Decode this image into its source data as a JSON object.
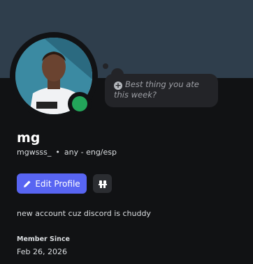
{
  "profile": {
    "display_name": "mg",
    "username": "mgwsss_",
    "pronouns": "any - eng/esp",
    "separator": "•",
    "bio": "new account cuz discord is chuddy",
    "status_color": "#23a55a",
    "banner_color": "#2f3e4c"
  },
  "custom_status": {
    "placeholder": "Best thing you ate this week?",
    "icon": "plus-circle-icon"
  },
  "actions": {
    "edit_profile_label": "Edit Profile",
    "edit_icon": "pencil-icon",
    "secondary_icon": "nitro-gift-icon",
    "accent": "#5865f2"
  },
  "member_since": {
    "label": "Member Since",
    "date": "Feb 26, 2026"
  }
}
